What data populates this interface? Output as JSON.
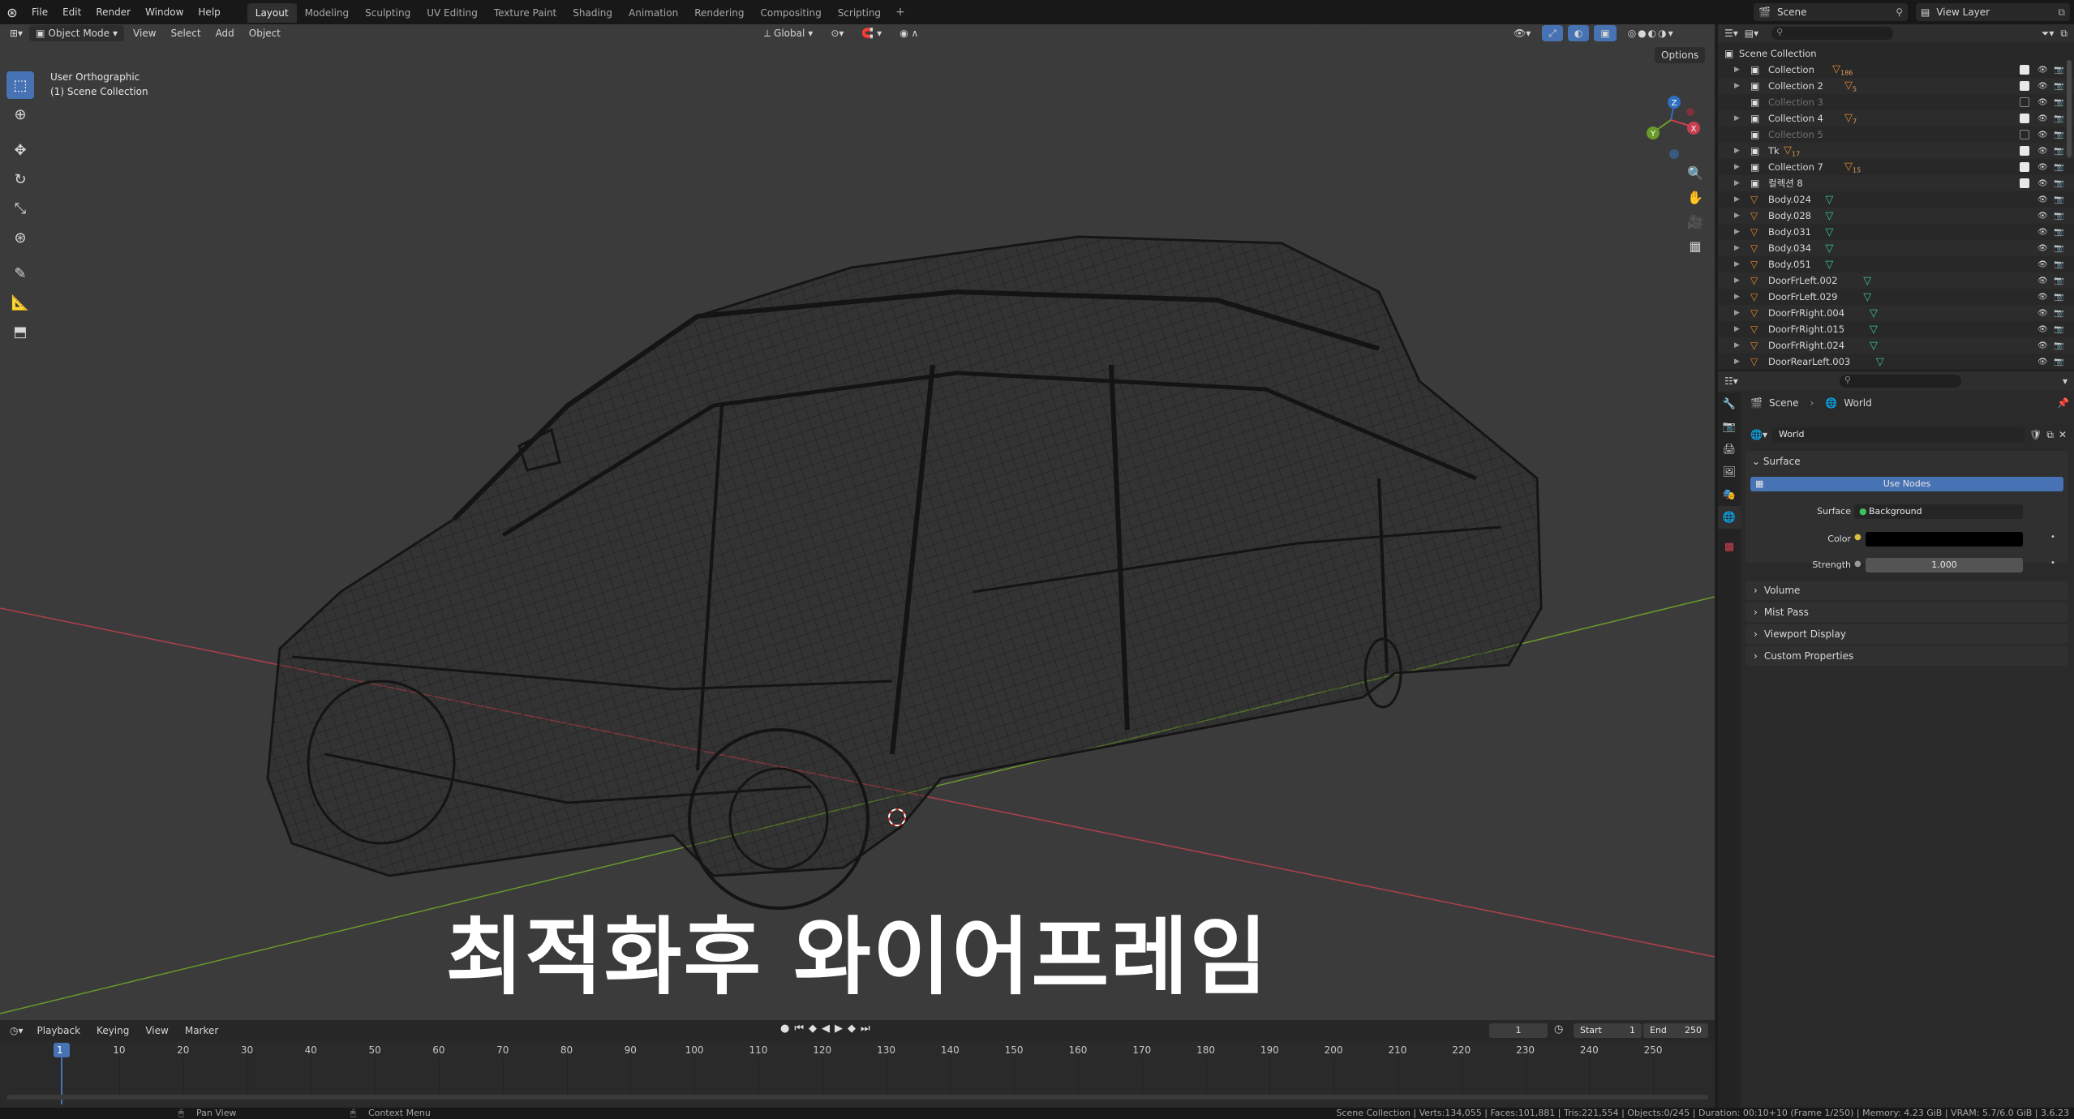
{
  "topbar": {
    "menus": [
      "File",
      "Edit",
      "Render",
      "Window",
      "Help"
    ],
    "workspaces": [
      "Layout",
      "Modeling",
      "Sculpting",
      "UV Editing",
      "Texture Paint",
      "Shading",
      "Animation",
      "Rendering",
      "Compositing",
      "Scripting"
    ],
    "active_workspace": "Layout",
    "scene": "Scene",
    "view_layer": "View Layer"
  },
  "viewport": {
    "mode": "Object Mode",
    "menus": [
      "View",
      "Select",
      "Add",
      "Object"
    ],
    "orientation": "Global",
    "options_label": "Options",
    "view_name": "User Orthographic",
    "collection_label": "(1) Scene Collection",
    "caption": "최적화후 와이어프레임",
    "gizmo_axes": [
      "X",
      "Y",
      "Z"
    ]
  },
  "outliner": {
    "root": "Scene Collection",
    "rows": [
      {
        "name": "Collection",
        "count": "186",
        "type": "collection",
        "checked": true,
        "dim": false
      },
      {
        "name": "Collection 2",
        "count": "5",
        "type": "collection",
        "checked": true,
        "dim": false
      },
      {
        "name": "Collection 3",
        "count": "",
        "type": "collection",
        "checked": false,
        "dim": true
      },
      {
        "name": "Collection 4",
        "count": "7",
        "type": "collection",
        "checked": true,
        "dim": false
      },
      {
        "name": "Collection 5",
        "count": "",
        "type": "collection",
        "checked": false,
        "dim": true
      },
      {
        "name": "Tk",
        "count": "17",
        "type": "collection",
        "checked": true,
        "dim": false
      },
      {
        "name": "Collection 7",
        "count": "15",
        "type": "collection",
        "checked": true,
        "dim": false
      },
      {
        "name": "컬렉션 8",
        "count": "",
        "type": "collection",
        "checked": true,
        "dim": false
      },
      {
        "name": "Body.024",
        "count": "",
        "type": "object",
        "checked": false,
        "dim": false
      },
      {
        "name": "Body.028",
        "count": "",
        "type": "object",
        "checked": false,
        "dim": false
      },
      {
        "name": "Body.031",
        "count": "",
        "type": "object",
        "checked": false,
        "dim": false
      },
      {
        "name": "Body.034",
        "count": "",
        "type": "object",
        "checked": false,
        "dim": false
      },
      {
        "name": "Body.051",
        "count": "",
        "type": "object",
        "checked": false,
        "dim": false
      },
      {
        "name": "DoorFrLeft.002",
        "count": "",
        "type": "object",
        "checked": false,
        "dim": false
      },
      {
        "name": "DoorFrLeft.029",
        "count": "",
        "type": "object",
        "checked": false,
        "dim": false
      },
      {
        "name": "DoorFrRight.004",
        "count": "",
        "type": "object",
        "checked": false,
        "dim": false
      },
      {
        "name": "DoorFrRight.015",
        "count": "",
        "type": "object",
        "checked": false,
        "dim": false
      },
      {
        "name": "DoorFrRight.024",
        "count": "",
        "type": "object",
        "checked": false,
        "dim": false
      },
      {
        "name": "DoorRearLeft.003",
        "count": "",
        "type": "object",
        "checked": false,
        "dim": false
      }
    ]
  },
  "properties": {
    "breadcrumb_scene": "Scene",
    "breadcrumb_world": "World",
    "world_name": "World",
    "surface_header": "Surface",
    "use_nodes": "Use Nodes",
    "surface_label": "Surface",
    "surface_value": "Background",
    "color_label": "Color",
    "color_value": "#000000",
    "strength_label": "Strength",
    "strength_value": "1.000",
    "sections": [
      "Volume",
      "Mist Pass",
      "Viewport Display",
      "Custom Properties"
    ]
  },
  "timeline": {
    "menus": [
      "Playback",
      "Keying",
      "View",
      "Marker"
    ],
    "current_frame": "1",
    "start_label": "Start",
    "start": "1",
    "end_label": "End",
    "end": "250",
    "ticks": [
      "1",
      "10",
      "20",
      "30",
      "40",
      "50",
      "60",
      "70",
      "80",
      "90",
      "100",
      "110",
      "120",
      "130",
      "140",
      "150",
      "160",
      "170",
      "180",
      "190",
      "200",
      "210",
      "220",
      "230",
      "240",
      "250"
    ]
  },
  "statusbar": {
    "left1": "Pan View",
    "left2": "Context Menu",
    "stats": "Scene Collection | Verts:134,055 | Faces:101,881 | Tris:221,554 | Objects:0/245 | Duration: 00:10+10 (Frame 1/250) | Memory: 4.23 GiB | VRAM: 5.7/6.0 GiB | 3.6.23"
  },
  "colors": {
    "accent": "#4772b3",
    "viewport_bg": "#3b3b3b",
    "x_axis": "#c0404a",
    "y_axis": "#6a9a2a",
    "wire": "#151515"
  }
}
